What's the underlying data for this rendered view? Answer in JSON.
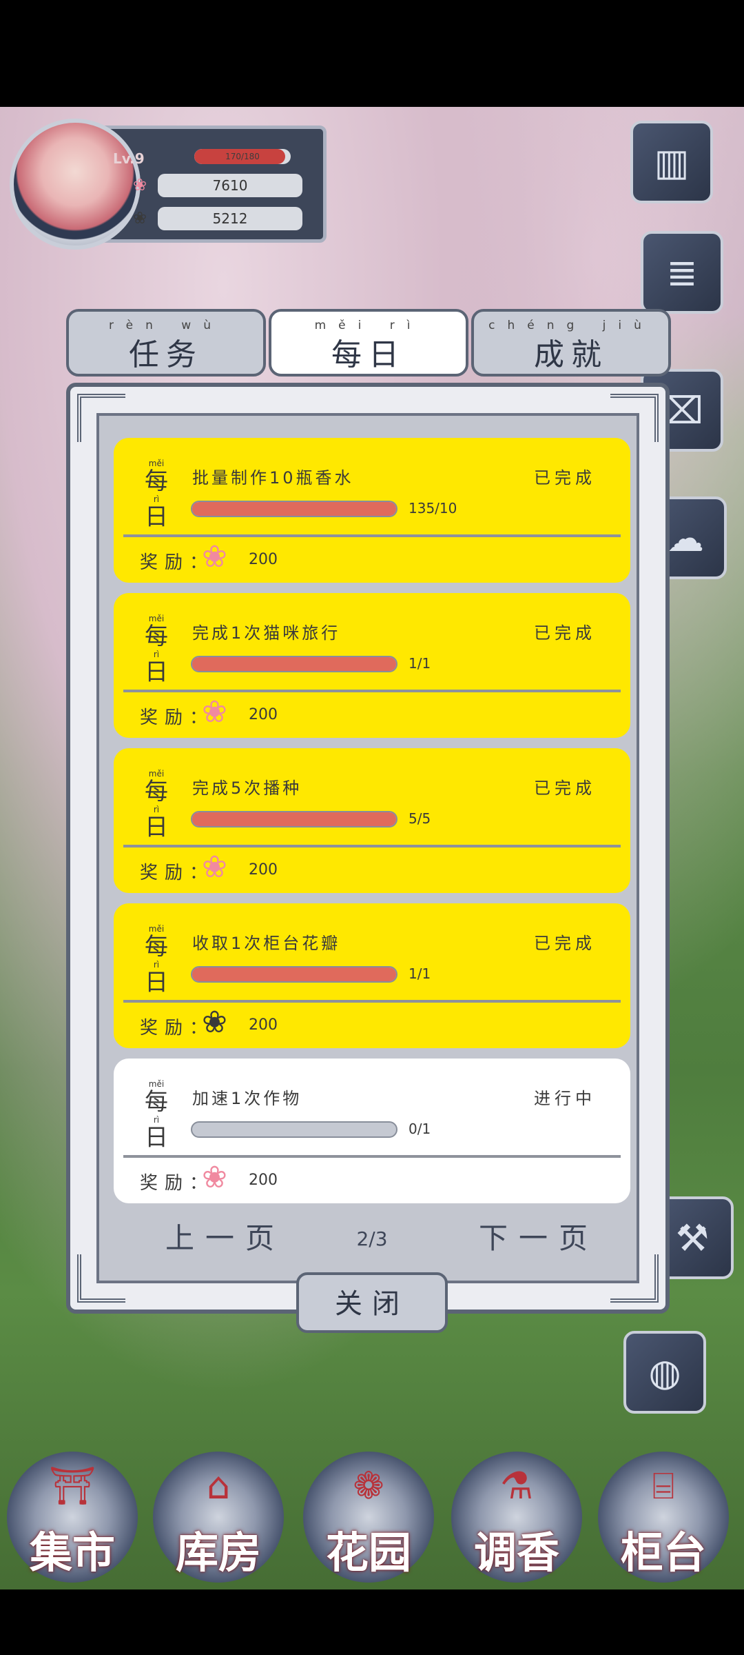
{
  "profile": {
    "level_label": "Lv.9",
    "exp_text": "170/180",
    "exp_progress": 0.94,
    "petals_pink": "7610",
    "petals_black": "5212"
  },
  "tabs": [
    {
      "pinyin": "rèn wù",
      "label": "任务"
    },
    {
      "pinyin": "měi rì",
      "label": "每日"
    },
    {
      "pinyin": "chéng jiù",
      "label": "成就"
    }
  ],
  "reward_label": "奖励：",
  "day_pinyin": [
    "měi",
    "rì"
  ],
  "day_label": [
    "每",
    "日"
  ],
  "tasks": [
    {
      "title": "批量制作10瓶香水",
      "progress_text": "135/10",
      "progress": 1.0,
      "status": "已完成",
      "reward_icon": "pink-petal-icon",
      "reward_amount": "200"
    },
    {
      "title": "完成1次猫咪旅行",
      "progress_text": "1/1",
      "progress": 1.0,
      "status": "已完成",
      "reward_icon": "pink-petal-icon",
      "reward_amount": "200"
    },
    {
      "title": "完成5次播种",
      "progress_text": "5/5",
      "progress": 1.0,
      "status": "已完成",
      "reward_icon": "pink-petal-icon",
      "reward_amount": "200"
    },
    {
      "title": "收取1次柜台花瓣",
      "progress_text": "1/1",
      "progress": 1.0,
      "status": "已完成",
      "reward_icon": "black-petal-icon",
      "reward_amount": "200"
    },
    {
      "title": "加速1次作物",
      "progress_text": "0/1",
      "progress": 0.0,
      "status": "进行中",
      "reward_icon": "pink-petal-icon",
      "reward_amount": "200"
    }
  ],
  "pager": {
    "prev": "上一页",
    "next": "下一页",
    "page": "2/3"
  },
  "close_label": "关闭",
  "nav": [
    {
      "label": "集市",
      "icon": "gate-icon"
    },
    {
      "label": "库房",
      "icon": "warehouse-icon"
    },
    {
      "label": "花园",
      "icon": "rose-icon"
    },
    {
      "label": "调香",
      "icon": "perfume-icon"
    },
    {
      "label": "柜台",
      "icon": "counter-icon"
    }
  ]
}
